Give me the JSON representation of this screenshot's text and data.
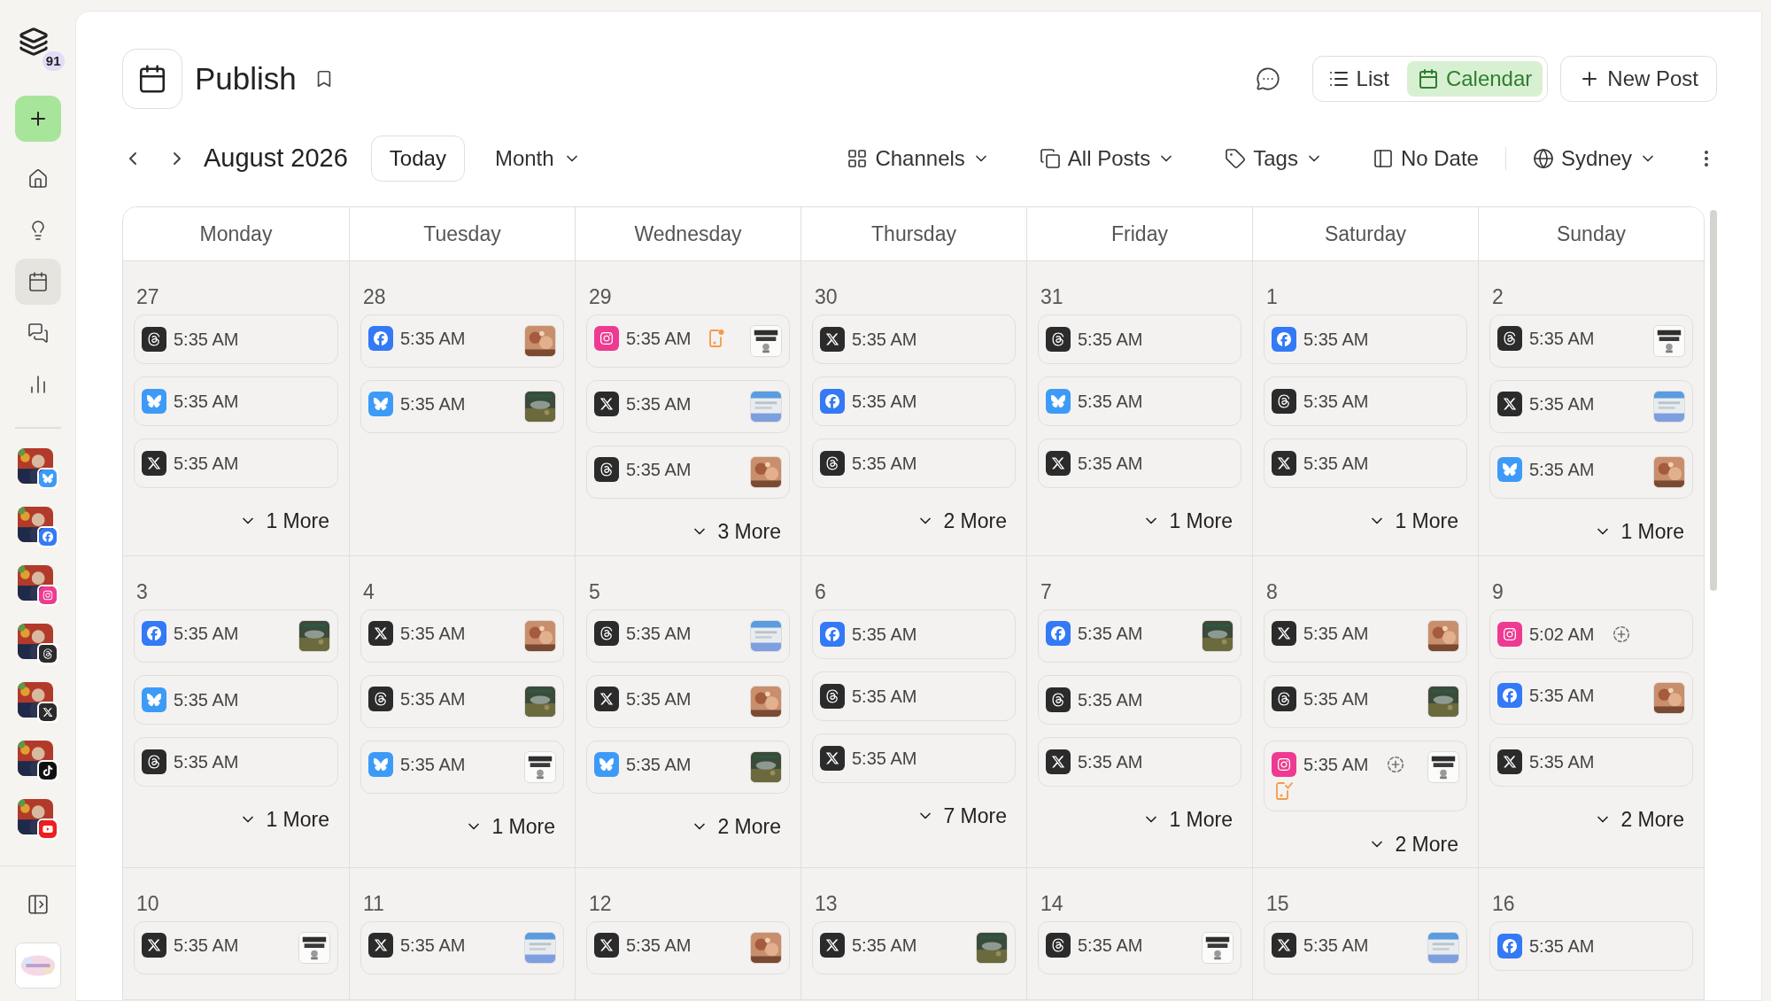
{
  "sidebar": {
    "logo_badge": "91",
    "nav": [
      {
        "kind": "home",
        "selected": false
      },
      {
        "kind": "ideas",
        "selected": false
      },
      {
        "kind": "calendar",
        "selected": true
      },
      {
        "kind": "messages",
        "selected": false
      },
      {
        "kind": "analytics",
        "selected": false
      }
    ],
    "accounts": [
      {
        "kind": "bluesky"
      },
      {
        "kind": "facebook"
      },
      {
        "kind": "instagram"
      },
      {
        "kind": "threads"
      },
      {
        "kind": "x"
      },
      {
        "kind": "tiktok"
      },
      {
        "kind": "youtube"
      }
    ]
  },
  "header": {
    "title": "Publish",
    "views": [
      {
        "label": "List",
        "kind": "list",
        "selected": false
      },
      {
        "label": "Calendar",
        "kind": "calendar",
        "selected": true
      }
    ],
    "new_post": "New Post"
  },
  "toolbar": {
    "period": "August 2026",
    "today": "Today",
    "range": "Month",
    "filters": [
      {
        "label": "Channels",
        "kind": "channels",
        "dropdown": true
      },
      {
        "label": "All Posts",
        "kind": "posts",
        "dropdown": true
      },
      {
        "label": "Tags",
        "kind": "tags",
        "dropdown": true
      },
      {
        "label": "No Date",
        "kind": "nodate",
        "dropdown": false
      },
      {
        "label": "Sydney",
        "kind": "timezone",
        "dropdown": true
      }
    ]
  },
  "calendar": {
    "weekdays": [
      "Monday",
      "Tuesday",
      "Wednesday",
      "Thursday",
      "Friday",
      "Saturday",
      "Sunday"
    ],
    "weeks": [
      [
        {
          "day": "27",
          "posts": [
            {
              "kind": "threads",
              "time": "5:35 AM",
              "thumbnail": false
            },
            {
              "kind": "bluesky",
              "time": "5:35 AM",
              "thumbnail": false
            },
            {
              "kind": "x",
              "time": "5:35 AM",
              "thumbnail": false
            }
          ],
          "more": "1 More"
        },
        {
          "day": "28",
          "posts": [
            {
              "kind": "facebook",
              "time": "5:35 AM",
              "thumbnail": true
            },
            {
              "kind": "bluesky",
              "time": "5:35 AM",
              "thumbnail": true
            }
          ]
        },
        {
          "day": "29",
          "posts": [
            {
              "kind": "instagram",
              "time": "5:35 AM",
              "thumbnail": true,
              "markers": [
                {
                  "kind": "reminder"
                }
              ]
            },
            {
              "kind": "x",
              "time": "5:35 AM",
              "thumbnail": true
            },
            {
              "kind": "threads",
              "time": "5:35 AM",
              "thumbnail": true
            }
          ],
          "more": "3 More"
        },
        {
          "day": "30",
          "posts": [
            {
              "kind": "x",
              "time": "5:35 AM",
              "thumbnail": false
            },
            {
              "kind": "facebook",
              "time": "5:35 AM",
              "thumbnail": false
            },
            {
              "kind": "threads",
              "time": "5:35 AM",
              "thumbnail": false
            }
          ],
          "more": "2 More"
        },
        {
          "day": "31",
          "posts": [
            {
              "kind": "threads",
              "time": "5:35 AM",
              "thumbnail": false
            },
            {
              "kind": "bluesky",
              "time": "5:35 AM",
              "thumbnail": false
            },
            {
              "kind": "x",
              "time": "5:35 AM",
              "thumbnail": false
            }
          ],
          "more": "1 More"
        },
        {
          "day": "1",
          "posts": [
            {
              "kind": "facebook",
              "time": "5:35 AM",
              "thumbnail": false
            },
            {
              "kind": "threads",
              "time": "5:35 AM",
              "thumbnail": false
            },
            {
              "kind": "x",
              "time": "5:35 AM",
              "thumbnail": false
            }
          ],
          "more": "1 More"
        },
        {
          "day": "2",
          "posts": [
            {
              "kind": "threads",
              "time": "5:35 AM",
              "thumbnail": true
            },
            {
              "kind": "x",
              "time": "5:35 AM",
              "thumbnail": true
            },
            {
              "kind": "bluesky",
              "time": "5:35 AM",
              "thumbnail": true
            }
          ],
          "more": "1 More"
        }
      ],
      [
        {
          "day": "3",
          "posts": [
            {
              "kind": "facebook",
              "time": "5:35 AM",
              "thumbnail": true
            },
            {
              "kind": "bluesky",
              "time": "5:35 AM",
              "thumbnail": false
            },
            {
              "kind": "threads",
              "time": "5:35 AM",
              "thumbnail": false
            }
          ],
          "more": "1 More"
        },
        {
          "day": "4",
          "posts": [
            {
              "kind": "x",
              "time": "5:35 AM",
              "thumbnail": true
            },
            {
              "kind": "threads",
              "time": "5:35 AM",
              "thumbnail": true
            },
            {
              "kind": "bluesky",
              "time": "5:35 AM",
              "thumbnail": true
            }
          ],
          "more": "1 More"
        },
        {
          "day": "5",
          "posts": [
            {
              "kind": "threads",
              "time": "5:35 AM",
              "thumbnail": true
            },
            {
              "kind": "x",
              "time": "5:35 AM",
              "thumbnail": true
            },
            {
              "kind": "bluesky",
              "time": "5:35 AM",
              "thumbnail": true
            }
          ],
          "more": "2 More"
        },
        {
          "day": "6",
          "posts": [
            {
              "kind": "facebook",
              "time": "5:35 AM",
              "thumbnail": false
            },
            {
              "kind": "threads",
              "time": "5:35 AM",
              "thumbnail": false
            },
            {
              "kind": "x",
              "time": "5:35 AM",
              "thumbnail": false
            }
          ],
          "more": "7 More"
        },
        {
          "day": "7",
          "posts": [
            {
              "kind": "facebook",
              "time": "5:35 AM",
              "thumbnail": true
            },
            {
              "kind": "threads",
              "time": "5:35 AM",
              "thumbnail": false
            },
            {
              "kind": "x",
              "time": "5:35 AM",
              "thumbnail": false
            }
          ],
          "more": "1 More"
        },
        {
          "day": "8",
          "posts": [
            {
              "kind": "x",
              "time": "5:35 AM",
              "thumbnail": true
            },
            {
              "kind": "threads",
              "time": "5:35 AM",
              "thumbnail": true
            },
            {
              "kind": "instagram",
              "time": "5:35 AM",
              "thumbnail": true,
              "markers": [
                {
                  "kind": "pending"
                },
                {
                  "kind": "phone-checked"
                }
              ]
            }
          ],
          "more": "2 More"
        },
        {
          "day": "9",
          "posts": [
            {
              "kind": "instagram",
              "time": "5:02 AM",
              "thumbnail": false,
              "markers": [
                {
                  "kind": "pending"
                }
              ]
            },
            {
              "kind": "facebook",
              "time": "5:35 AM",
              "thumbnail": true
            },
            {
              "kind": "x",
              "time": "5:35 AM",
              "thumbnail": false
            }
          ],
          "more": "2 More"
        }
      ],
      [
        {
          "day": "10",
          "posts": [
            {
              "kind": "x",
              "time": "5:35 AM",
              "thumbnail": true
            }
          ]
        },
        {
          "day": "11",
          "posts": [
            {
              "kind": "x",
              "time": "5:35 AM",
              "thumbnail": true
            }
          ]
        },
        {
          "day": "12",
          "posts": [
            {
              "kind": "x",
              "time": "5:35 AM",
              "thumbnail": true
            }
          ]
        },
        {
          "day": "13",
          "posts": [
            {
              "kind": "x",
              "time": "5:35 AM",
              "thumbnail": true
            }
          ]
        },
        {
          "day": "14",
          "posts": [
            {
              "kind": "threads",
              "time": "5:35 AM",
              "thumbnail": true
            }
          ]
        },
        {
          "day": "15",
          "posts": [
            {
              "kind": "x",
              "time": "5:35 AM",
              "thumbnail": true
            }
          ]
        },
        {
          "day": "16",
          "posts": [
            {
              "kind": "facebook",
              "time": "5:35 AM",
              "thumbnail": false
            }
          ]
        }
      ]
    ]
  }
}
